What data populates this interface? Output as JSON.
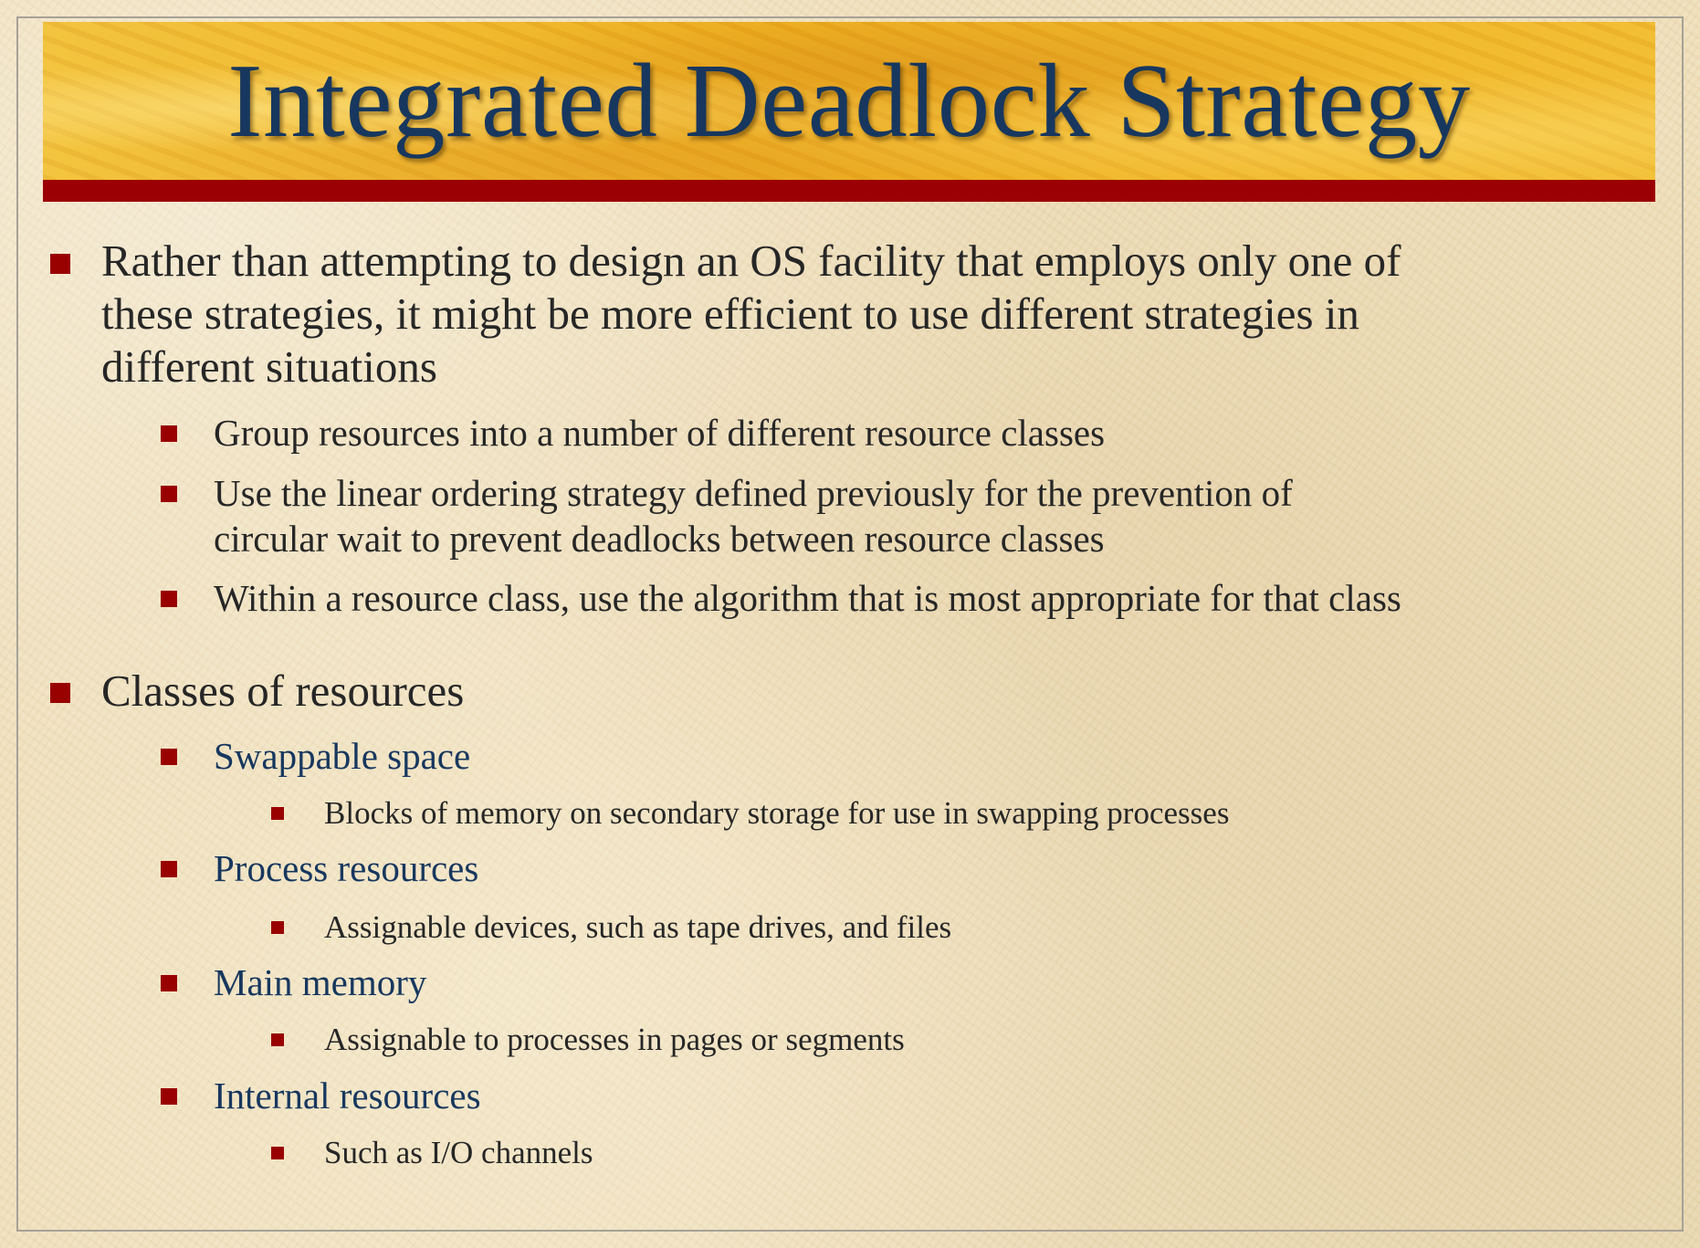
{
  "slide": {
    "title": "Integrated Deadlock Strategy",
    "point1": {
      "lines": [
        "Rather than attempting to design an OS facility that employs only one of",
        "these strategies, it might be more efficient to use different strategies in",
        "different situations"
      ],
      "subpoints": [
        {
          "lines": [
            "Group resources into a number of different resource classes"
          ]
        },
        {
          "lines": [
            "Use the linear ordering strategy defined previously for the prevention of",
            "circular wait to prevent deadlocks between resource classes"
          ]
        },
        {
          "lines": [
            "Within a resource class, use the algorithm that is most appropriate for that class"
          ]
        }
      ]
    },
    "point2": {
      "text": "Classes of resources",
      "classes": [
        {
          "name": "Swappable space",
          "detail": "Blocks of memory on secondary storage for use in swapping processes"
        },
        {
          "name": "Process resources",
          "detail": "Assignable devices, such as tape drives, and files"
        },
        {
          "name": "Main memory",
          "detail": "Assignable to processes in pages or segments"
        },
        {
          "name": "Internal resources",
          "detail": "Such as I/O channels"
        }
      ]
    }
  },
  "colors": {
    "title": "#17375e",
    "bullet": "#990000",
    "body_text": "#262626",
    "class_name": "#17375e",
    "banner": "#f0b920",
    "banner_underline": "#9b0004",
    "background": "#efdfb9"
  }
}
